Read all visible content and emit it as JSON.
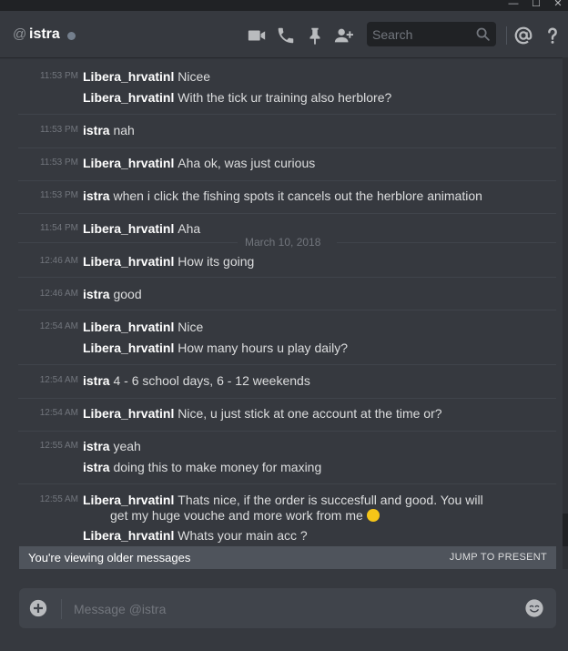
{
  "window_controls": {
    "minimize": "—",
    "maximize": "☐",
    "close": "✕"
  },
  "header": {
    "at_symbol": "@",
    "channel_name": "istra",
    "search_placeholder": "Search"
  },
  "icons": {
    "video": "video-call-icon",
    "call": "voice-call-icon",
    "pin": "pin-icon",
    "add_friend": "add-friend-icon",
    "search": "search-icon",
    "mentions": "mentions-icon",
    "help": "help-icon",
    "upload": "upload-plus-icon",
    "emoji": "emoji-icon"
  },
  "colors": {
    "background": "#36393f",
    "header": "#36393f",
    "status_offline": "#747f8d"
  },
  "messages": [
    {
      "lines": [
        {
          "time": "11:53 PM",
          "user": "Libera_hrvatinl",
          "text": "Nicee"
        },
        {
          "time": "",
          "user": "Libera_hrvatinl",
          "text": "With the tick ur training also herblore?"
        }
      ]
    },
    {
      "lines": [
        {
          "time": "11:53 PM",
          "user": "istra",
          "text": "nah"
        }
      ]
    },
    {
      "lines": [
        {
          "time": "11:53 PM",
          "user": "Libera_hrvatinl",
          "text": "Aha ok, was just curious"
        }
      ]
    },
    {
      "lines": [
        {
          "time": "11:53 PM",
          "user": "istra",
          "text": "when i click the fishing spots it cancels out the herblore animation"
        }
      ]
    },
    {
      "lines": [
        {
          "time": "11:54 PM",
          "user": "Libera_hrvatinl",
          "text": "Aha"
        }
      ]
    },
    {
      "lines": [
        {
          "time": "12:46 AM",
          "user": "Libera_hrvatinl",
          "text": "How its going"
        }
      ]
    },
    {
      "lines": [
        {
          "time": "12:46 AM",
          "user": "istra",
          "text": "good"
        }
      ]
    },
    {
      "lines": [
        {
          "time": "12:54 AM",
          "user": "Libera_hrvatinl",
          "text": "Nice"
        },
        {
          "time": "",
          "user": "Libera_hrvatinl",
          "text": "How many hours u play daily?"
        }
      ]
    },
    {
      "lines": [
        {
          "time": "12:54 AM",
          "user": "istra",
          "text": "4 - 6 school days, 6 - 12 weekends"
        }
      ]
    },
    {
      "lines": [
        {
          "time": "12:54 AM",
          "user": "Libera_hrvatinl",
          "text": "Nice, u just stick at one account at the time or?"
        }
      ]
    },
    {
      "lines": [
        {
          "time": "12:55 AM",
          "user": "istra",
          "text": "yeah"
        },
        {
          "time": "",
          "user": "istra",
          "text": "doing this to make money for maxing"
        }
      ]
    },
    {
      "lines": [
        {
          "time": "12:55 AM",
          "user": "Libera_hrvatinl",
          "text": "Thats nice, if the order is succesfull and good. You will",
          "cont": "get my huge vouche and more work from me"
        },
        {
          "time": "",
          "user": "Libera_hrvatinl",
          "text": "Whats your main acc ?"
        }
      ]
    }
  ],
  "date_separator": "March 10, 2018",
  "older_banner": {
    "text": "You're viewing older messages",
    "jump_label": "JUMP TO PRESENT"
  },
  "composer": {
    "placeholder": "Message @istra"
  }
}
